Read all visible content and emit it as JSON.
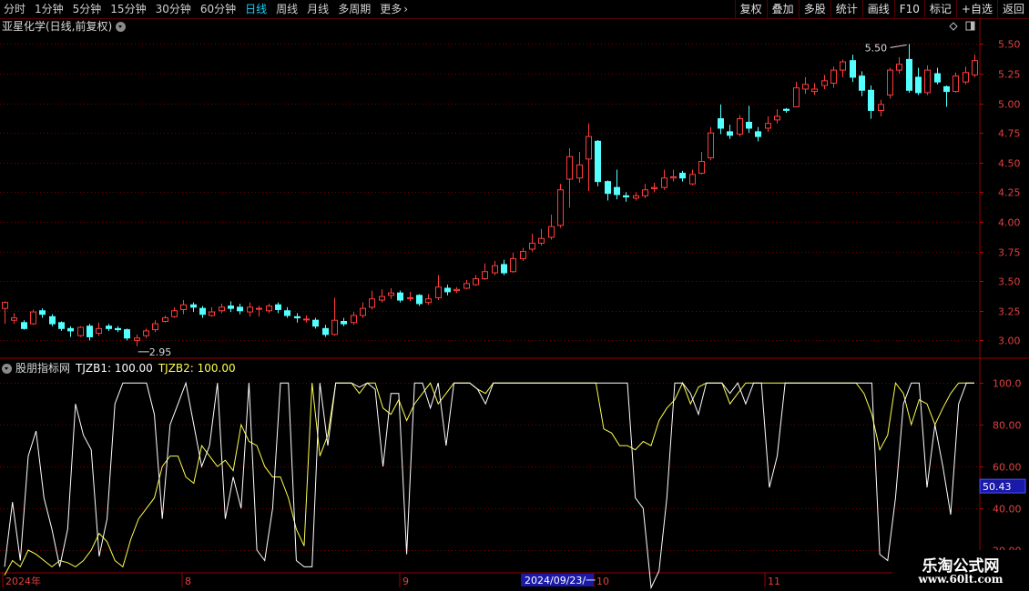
{
  "toolbar": {
    "periods": [
      "分时",
      "1分钟",
      "5分钟",
      "15分钟",
      "30分钟",
      "60分钟",
      "日线",
      "周线",
      "月线",
      "多周期",
      "更多"
    ],
    "active_period": "日线",
    "right_buttons": [
      "复权",
      "叠加",
      "多股",
      "统计",
      "画线",
      "F10",
      "标记",
      "+自选",
      "返回"
    ]
  },
  "chart": {
    "title": "亚星化学(日线,前复权)",
    "price_axis": [
      "5.50",
      "5.25",
      "5.00",
      "4.75",
      "4.50",
      "4.25",
      "4.00",
      "3.75",
      "3.50",
      "3.25",
      "3.00"
    ],
    "high_label": "5.50",
    "low_label": "2.95"
  },
  "indicator": {
    "name": "股朋指标网",
    "s1_label": "TJZB1: 100.00",
    "s2_label": "TJZB2: 100.00",
    "axis": [
      "100.0",
      "80.00",
      "60.00",
      "40.00",
      "20.00"
    ],
    "cursor_value": "50.43"
  },
  "time_axis": {
    "labels": [
      "2024年",
      "8",
      "9",
      "10",
      "11"
    ],
    "cursor_date": "2024/09/23/一"
  },
  "watermark": {
    "title": "乐淘公式网",
    "url": "www.60lt.com"
  },
  "colors": {
    "up": "#ff3b3b",
    "down": "#54ffff",
    "grid": "#7a0000",
    "s1": "#ffffff",
    "s2": "#ffff4d"
  },
  "chart_data": {
    "type": "candlestick",
    "candles": [
      [
        3.27,
        3.32,
        3.33,
        3.14
      ],
      [
        3.17,
        3.19,
        3.23,
        3.14
      ],
      [
        3.15,
        3.1,
        3.17,
        3.09
      ],
      [
        3.14,
        3.24,
        3.26,
        3.13
      ],
      [
        3.25,
        3.22,
        3.27,
        3.19
      ],
      [
        3.2,
        3.14,
        3.22,
        3.12
      ],
      [
        3.15,
        3.1,
        3.16,
        3.08
      ],
      [
        3.1,
        3.08,
        3.12,
        3.03
      ],
      [
        3.04,
        3.11,
        3.12,
        3.03
      ],
      [
        3.12,
        3.03,
        3.14,
        3.0
      ],
      [
        3.06,
        3.1,
        3.15,
        3.04
      ],
      [
        3.12,
        3.1,
        3.14,
        3.08
      ],
      [
        3.1,
        3.09,
        3.12,
        3.07
      ],
      [
        3.09,
        3.02,
        3.1,
        3.0
      ],
      [
        3.0,
        3.02,
        3.05,
        2.95
      ],
      [
        3.04,
        3.08,
        3.1,
        3.02
      ],
      [
        3.09,
        3.14,
        3.17,
        3.07
      ],
      [
        3.16,
        3.19,
        3.21,
        3.15
      ],
      [
        3.2,
        3.25,
        3.28,
        3.19
      ],
      [
        3.26,
        3.3,
        3.34,
        3.22
      ],
      [
        3.3,
        3.28,
        3.32,
        3.24
      ],
      [
        3.27,
        3.22,
        3.29,
        3.19
      ],
      [
        3.21,
        3.24,
        3.28,
        3.2
      ],
      [
        3.25,
        3.28,
        3.31,
        3.23
      ],
      [
        3.29,
        3.27,
        3.33,
        3.24
      ],
      [
        3.28,
        3.25,
        3.31,
        3.22
      ],
      [
        3.24,
        3.28,
        3.32,
        3.2
      ],
      [
        3.27,
        3.27,
        3.29,
        3.2
      ],
      [
        3.25,
        3.29,
        3.31,
        3.23
      ],
      [
        3.3,
        3.26,
        3.32,
        3.23
      ],
      [
        3.25,
        3.21,
        3.28,
        3.19
      ],
      [
        3.2,
        3.19,
        3.23,
        3.15
      ],
      [
        3.18,
        3.18,
        3.21,
        3.15
      ],
      [
        3.17,
        3.12,
        3.19,
        3.1
      ],
      [
        3.1,
        3.05,
        3.13,
        3.03
      ],
      [
        3.05,
        3.17,
        3.36,
        3.04
      ],
      [
        3.16,
        3.14,
        3.19,
        3.12
      ],
      [
        3.15,
        3.21,
        3.24,
        3.13
      ],
      [
        3.21,
        3.27,
        3.32,
        3.19
      ],
      [
        3.28,
        3.35,
        3.42,
        3.26
      ],
      [
        3.34,
        3.37,
        3.43,
        3.32
      ],
      [
        3.38,
        3.4,
        3.44,
        3.35
      ],
      [
        3.4,
        3.34,
        3.42,
        3.32
      ],
      [
        3.36,
        3.36,
        3.41,
        3.33
      ],
      [
        3.38,
        3.31,
        3.39,
        3.29
      ],
      [
        3.32,
        3.35,
        3.39,
        3.3
      ],
      [
        3.36,
        3.45,
        3.55,
        3.34
      ],
      [
        3.44,
        3.41,
        3.47,
        3.38
      ],
      [
        3.42,
        3.43,
        3.45,
        3.4
      ],
      [
        3.44,
        3.48,
        3.51,
        3.43
      ],
      [
        3.47,
        3.52,
        3.55,
        3.46
      ],
      [
        3.52,
        3.58,
        3.65,
        3.51
      ],
      [
        3.57,
        3.63,
        3.67,
        3.55
      ],
      [
        3.64,
        3.57,
        3.68,
        3.55
      ],
      [
        3.58,
        3.69,
        3.74,
        3.57
      ],
      [
        3.69,
        3.75,
        3.78,
        3.67
      ],
      [
        3.77,
        3.82,
        3.9,
        3.75
      ],
      [
        3.82,
        3.86,
        3.94,
        3.8
      ],
      [
        3.87,
        3.96,
        4.06,
        3.85
      ],
      [
        3.97,
        4.27,
        4.32,
        3.95
      ],
      [
        4.36,
        4.55,
        4.62,
        4.12
      ],
      [
        4.37,
        4.48,
        4.59,
        4.33
      ],
      [
        4.53,
        4.72,
        4.83,
        4.26
      ],
      [
        4.68,
        4.34,
        4.69,
        4.3
      ],
      [
        4.34,
        4.24,
        4.35,
        4.18
      ],
      [
        4.29,
        4.23,
        4.44,
        4.19
      ],
      [
        4.22,
        4.21,
        4.25,
        4.17
      ],
      [
        4.2,
        4.22,
        4.25,
        4.18
      ],
      [
        4.22,
        4.27,
        4.32,
        4.2
      ],
      [
        4.28,
        4.29,
        4.33,
        4.25
      ],
      [
        4.29,
        4.37,
        4.44,
        4.27
      ],
      [
        4.37,
        4.38,
        4.44,
        4.34
      ],
      [
        4.41,
        4.37,
        4.43,
        4.34
      ],
      [
        4.32,
        4.4,
        4.44,
        4.31
      ],
      [
        4.41,
        4.51,
        4.59,
        4.4
      ],
      [
        4.54,
        4.75,
        4.8,
        4.52
      ],
      [
        4.87,
        4.79,
        4.99,
        4.74
      ],
      [
        4.76,
        4.73,
        4.82,
        4.7
      ],
      [
        4.74,
        4.87,
        4.9,
        4.72
      ],
      [
        4.84,
        4.79,
        4.98,
        4.75
      ],
      [
        4.76,
        4.72,
        4.8,
        4.68
      ],
      [
        4.79,
        4.83,
        4.89,
        4.76
      ],
      [
        4.86,
        4.89,
        4.95,
        4.83
      ],
      [
        4.95,
        4.94,
        4.96,
        4.92
      ],
      [
        4.97,
        5.13,
        5.18,
        4.97
      ],
      [
        5.12,
        5.16,
        5.22,
        5.08
      ],
      [
        5.1,
        5.12,
        5.17,
        5.07
      ],
      [
        5.15,
        5.19,
        5.24,
        5.12
      ],
      [
        5.17,
        5.28,
        5.31,
        5.13
      ],
      [
        5.28,
        5.35,
        5.37,
        5.22
      ],
      [
        5.36,
        5.22,
        5.41,
        5.18
      ],
      [
        5.23,
        5.11,
        5.27,
        5.06
      ],
      [
        5.11,
        4.94,
        5.15,
        4.87
      ],
      [
        4.94,
        4.99,
        5.03,
        4.89
      ],
      [
        5.07,
        5.28,
        5.3,
        5.04
      ],
      [
        5.28,
        5.33,
        5.39,
        5.25
      ],
      [
        5.37,
        5.11,
        5.5,
        5.09
      ],
      [
        5.22,
        5.09,
        5.3,
        5.07
      ],
      [
        5.09,
        5.28,
        5.32,
        5.07
      ],
      [
        5.25,
        5.18,
        5.3,
        5.16
      ],
      [
        5.14,
        5.1,
        5.15,
        4.97
      ],
      [
        5.1,
        5.23,
        5.26,
        5.09
      ],
      [
        5.18,
        5.26,
        5.31,
        5.16
      ],
      [
        5.24,
        5.36,
        5.41,
        5.22
      ]
    ],
    "ylim": [
      2.88,
      5.58
    ],
    "indicator_ylim": [
      10,
      104
    ],
    "tjzb1": [
      12,
      43,
      15,
      65,
      77,
      45,
      30,
      12,
      30,
      90,
      75,
      68,
      17,
      35,
      90,
      100,
      100,
      100,
      100,
      85,
      35,
      80,
      90,
      100,
      80,
      60,
      70,
      100,
      35,
      55,
      40,
      100,
      20,
      15,
      40,
      100,
      100,
      15,
      12,
      12,
      100,
      70,
      100,
      100,
      100,
      98,
      100,
      97,
      60,
      95,
      95,
      18,
      100,
      100,
      88,
      100,
      70,
      100,
      100,
      100,
      97,
      90,
      100,
      100,
      100,
      100,
      100,
      100,
      100,
      100,
      100,
      100,
      100,
      100,
      100,
      100,
      100,
      100,
      100,
      100,
      45,
      40,
      2,
      10,
      45,
      100,
      100,
      95,
      85,
      100,
      100,
      100,
      95,
      100,
      90,
      100,
      100,
      50,
      65,
      100,
      100,
      100,
      100,
      100,
      100,
      100,
      100,
      100,
      100,
      100,
      100,
      18,
      15,
      45,
      90,
      100,
      100,
      50,
      80,
      60,
      37,
      90,
      100,
      100
    ],
    "tjzb2": [
      8,
      15,
      12,
      20,
      18,
      15,
      12,
      15,
      14,
      12,
      15,
      20,
      28,
      24,
      15,
      12,
      25,
      35,
      40,
      45,
      60,
      65,
      65,
      55,
      52,
      70,
      65,
      60,
      63,
      58,
      80,
      72,
      70,
      60,
      55,
      55,
      45,
      30,
      22,
      100,
      65,
      75,
      100,
      100,
      100,
      95,
      100,
      100,
      88,
      85,
      92,
      82,
      90,
      95,
      100,
      90,
      95,
      100,
      100,
      100,
      97,
      95,
      100,
      100,
      100,
      100,
      100,
      100,
      100,
      100,
      100,
      100,
      100,
      100,
      100,
      100,
      78,
      76,
      70,
      70,
      68,
      72,
      70,
      82,
      88,
      92,
      100,
      90,
      98,
      100,
      100,
      100,
      90,
      95,
      100,
      100,
      100,
      100,
      100,
      100,
      100,
      100,
      100,
      100,
      100,
      100,
      100,
      100,
      100,
      95,
      85,
      68,
      75,
      100,
      95,
      80,
      92,
      90,
      80,
      88,
      95,
      100,
      100,
      100
    ]
  }
}
